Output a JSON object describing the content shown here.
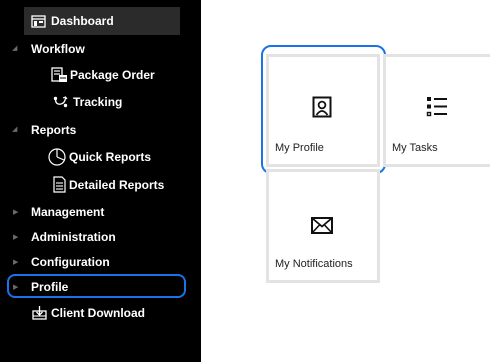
{
  "sidebar": {
    "dashboard": "Dashboard",
    "workflow": "Workflow",
    "package_order": "Package Order",
    "tracking": "Tracking",
    "reports": "Reports",
    "quick_reports": "Quick Reports",
    "detailed_reports": "Detailed Reports",
    "management": "Management",
    "administration": "Administration",
    "configuration": "Configuration",
    "profile": "Profile",
    "client_download": "Client Download"
  },
  "tiles": {
    "my_profile": "My Profile",
    "my_tasks": "My Tasks",
    "my_notifications": "My Notifications"
  },
  "colors": {
    "sidebar_bg": "#000000",
    "highlight": "#1a73e8",
    "tile_border": "#e3e3e3"
  },
  "icons": [
    "dashboard-icon",
    "package-order-icon",
    "tracking-icon",
    "quick-reports-icon",
    "detailed-reports-icon",
    "client-download-icon",
    "profile-icon",
    "tasks-icon",
    "notifications-icon"
  ]
}
